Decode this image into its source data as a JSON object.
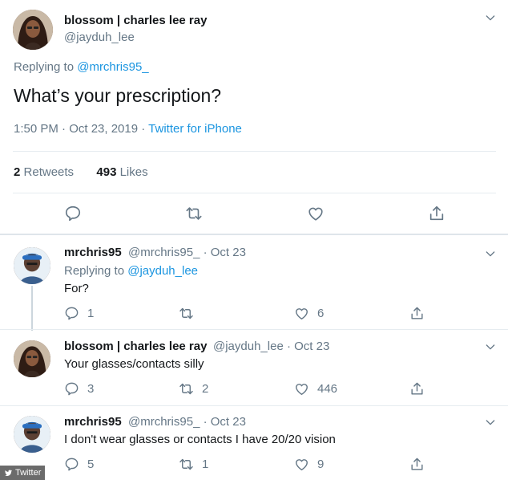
{
  "main_tweet": {
    "name": "blossom | charles lee ray",
    "handle": "@jayduh_lee",
    "replying_prefix": "Replying to",
    "replying_to": "@mrchris95_",
    "text": "What’s your prescription?",
    "timestamp": "1:50 PM · Oct 23, 2019 ·",
    "source": "Twitter for iPhone",
    "retweets_count": "2",
    "retweets_label": "Retweets",
    "likes_count": "493",
    "likes_label": "Likes"
  },
  "replies": [
    {
      "name": "mrchris95",
      "handle": "@mrchris95_",
      "date": "· Oct 23",
      "replying_prefix": "Replying to",
      "replying_to": "@jayduh_lee",
      "text": "For?",
      "replies": "1",
      "retweets": "",
      "likes": "6"
    },
    {
      "name": "blossom | charles lee ray",
      "handle": "@jayduh_lee",
      "date": "· Oct 23",
      "text": "Your glasses/contacts silly",
      "replies": "3",
      "retweets": "2",
      "likes": "446"
    },
    {
      "name": "mrchris95",
      "handle": "@mrchris95_",
      "date": "· Oct 23",
      "text": "I don't wear glasses or contacts I have 20/20 vision",
      "replies": "5",
      "retweets": "1",
      "likes": "9"
    }
  ],
  "watermark": "Twitter",
  "colors": {
    "link": "#1b95e0",
    "muted": "#657786",
    "text": "#14171a",
    "divider": "#e6ecf0"
  }
}
